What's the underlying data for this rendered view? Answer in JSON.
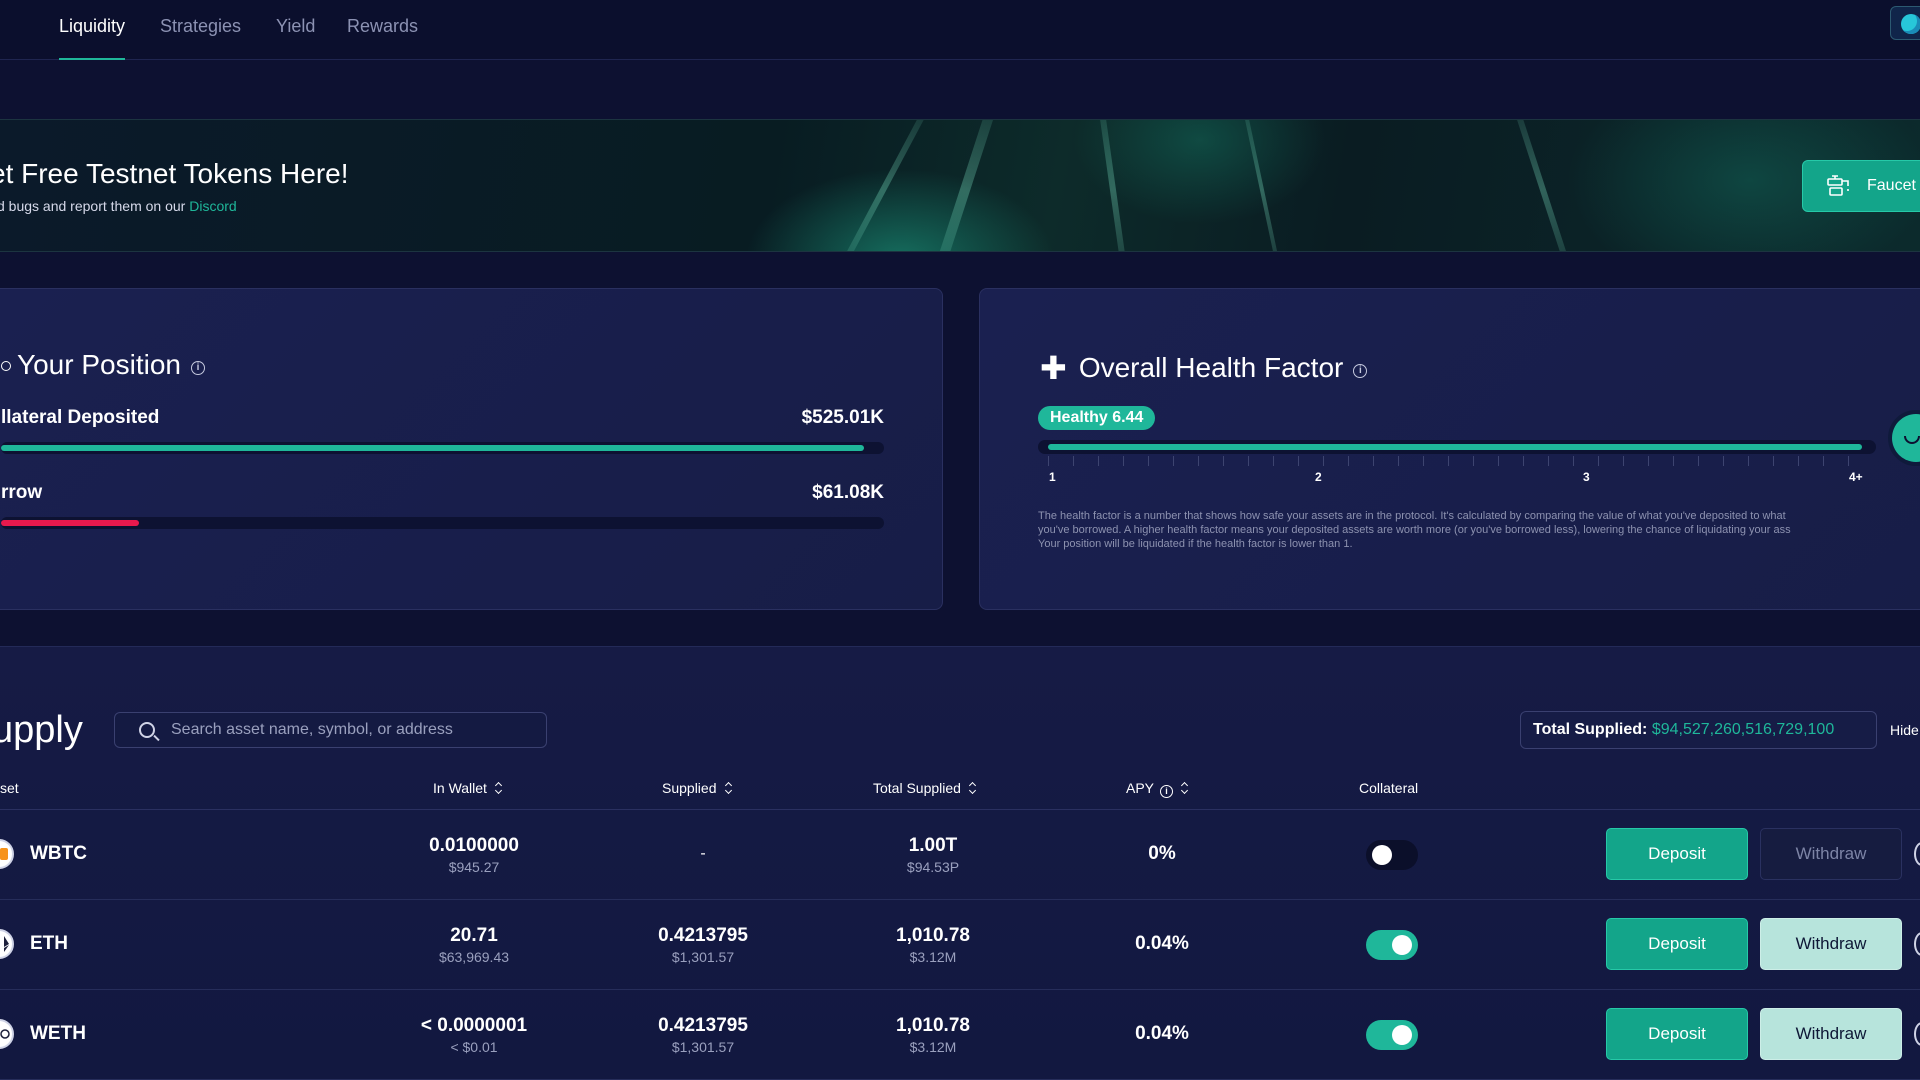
{
  "nav": {
    "tabs": [
      {
        "label": "Liquidity",
        "active": true
      },
      {
        "label": "Strategies",
        "active": false
      },
      {
        "label": "Yield",
        "active": false
      },
      {
        "label": "Rewards",
        "active": false
      }
    ]
  },
  "banner": {
    "title": "et Free Testnet Tokens Here!",
    "subtitle_prefix": "d bugs and report them on our ",
    "subtitle_link": "Discord",
    "faucet_label": "Faucet"
  },
  "position": {
    "title": "Your Position",
    "collateral_label": "llateral Deposited",
    "collateral_value": "$525.01K",
    "collateral_fraction": 1.0,
    "borrow_label": "rrow",
    "borrow_value": "$61.08K",
    "borrow_fraction": 0.16
  },
  "health": {
    "title": "Overall Health Factor",
    "badge": "Healthy 6.44",
    "fill_fraction": 1.0,
    "ticks": [
      "1",
      "2",
      "3",
      "4+"
    ],
    "description_lines": [
      "The health factor is a number that shows how safe your assets are in the protocol. It's calculated by comparing the value of what you've deposited to what",
      "you've borrowed. A higher health factor means your deposited assets are worth more (or you've borrowed less), lowering the chance of liquidating your ass",
      "Your position will be liquidated if the health factor is lower than 1."
    ]
  },
  "supply": {
    "title": "upply",
    "search_placeholder": "Search asset name, symbol, or address",
    "total_label": "Total Supplied:",
    "total_value": "$94,527,260,516,729,100",
    "hide_label": "Hide",
    "columns": {
      "asset": "set",
      "in_wallet": "In Wallet",
      "supplied": "Supplied",
      "total_supplied": "Total Supplied",
      "apy": "APY",
      "collateral": "Collateral"
    },
    "rows": [
      {
        "asset": "WBTC",
        "wallet": "0.0100000",
        "wallet_usd": "$945.27",
        "supplied": "-",
        "supplied_usd": "",
        "total": "1.00T",
        "total_usd": "$94.53P",
        "apy": "0%",
        "collateral": false,
        "deposit": "Deposit",
        "withdraw": "Withdraw",
        "withdraw_enabled": false
      },
      {
        "asset": "ETH",
        "wallet": "20.71",
        "wallet_usd": "$63,969.43",
        "supplied": "0.4213795",
        "supplied_usd": "$1,301.57",
        "total": "1,010.78",
        "total_usd": "$3.12M",
        "apy": "0.04%",
        "collateral": true,
        "deposit": "Deposit",
        "withdraw": "Withdraw",
        "withdraw_enabled": true
      },
      {
        "asset": "WETH",
        "wallet": "< 0.0000001",
        "wallet_usd": "< $0.01",
        "supplied": "0.4213795",
        "supplied_usd": "$1,301.57",
        "total": "1,010.78",
        "total_usd": "$3.12M",
        "apy": "0.04%",
        "collateral": true,
        "deposit": "Deposit",
        "withdraw": "Withdraw",
        "withdraw_enabled": true
      }
    ]
  },
  "colors": {
    "accent": "#1fb79a",
    "borrow": "#e8194d",
    "background": "#0d1131"
  }
}
